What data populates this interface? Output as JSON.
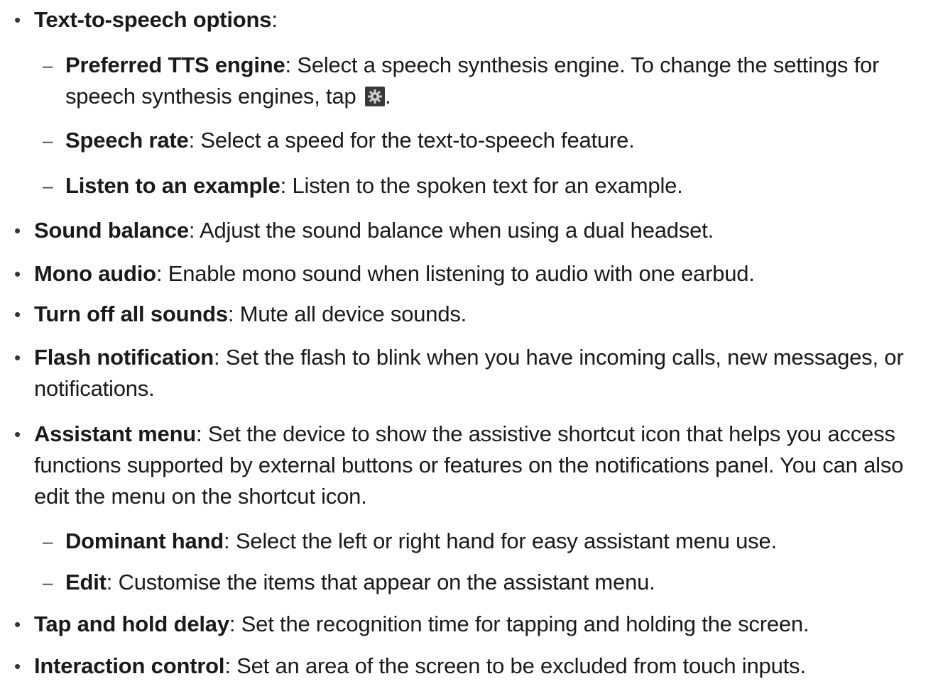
{
  "items": [
    {
      "level": 1,
      "term": "Text-to-speech options",
      "desc": ":"
    },
    {
      "level": 2,
      "term": "Preferred TTS engine",
      "desc": ": Select a speech synthesis engine. To change the settings for speech synthesis engines, tap ",
      "suffix": ".",
      "icon": "gear-icon"
    },
    {
      "level": 2,
      "term": "Speech rate",
      "desc": ": Select a speed for the text-to-speech feature."
    },
    {
      "level": 2,
      "term": "Listen to an example",
      "desc": ": Listen to the spoken text for an example."
    },
    {
      "level": 1,
      "term": "Sound balance",
      "desc": ": Adjust the sound balance when using a dual headset."
    },
    {
      "level": 1,
      "term": "Mono audio",
      "desc": ": Enable mono sound when listening to audio with one earbud."
    },
    {
      "level": 1,
      "term": "Turn off all sounds",
      "desc": ": Mute all device sounds."
    },
    {
      "level": 1,
      "term": "Flash notification",
      "desc": ": Set the flash to blink when you have incoming calls, new messages, or notifications."
    },
    {
      "level": 1,
      "term": "Assistant menu",
      "desc": ": Set the device to show the assistive shortcut icon that helps you access functions supported by external buttons or features on the notifications panel. You can also edit the menu on the shortcut icon."
    },
    {
      "level": 2,
      "term": "Dominant hand",
      "desc": ": Select the left or right hand for easy assistant menu use."
    },
    {
      "level": 2,
      "term": "Edit",
      "desc": ": Customise the items that appear on the assistant menu."
    },
    {
      "level": 1,
      "term": "Tap and hold delay",
      "desc": ": Set the recognition time for tapping and holding the screen."
    },
    {
      "level": 1,
      "term": "Interaction control",
      "desc": ": Set an area of the screen to be excluded from touch inputs."
    }
  ],
  "markers": {
    "bullet": "•",
    "dash": "–"
  }
}
